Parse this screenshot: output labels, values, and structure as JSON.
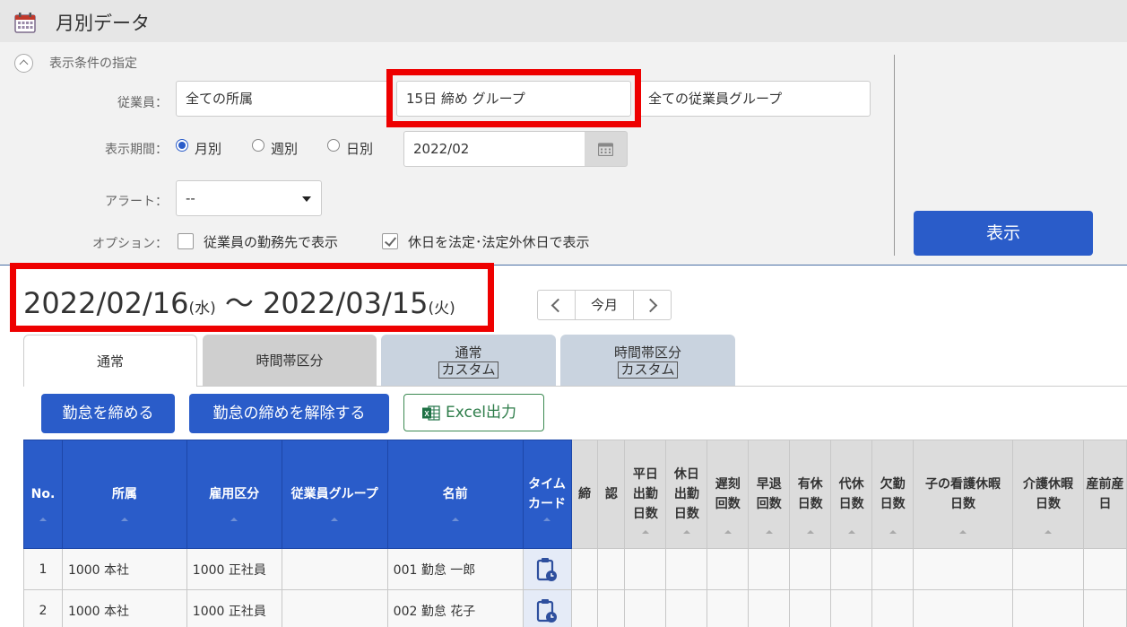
{
  "header": {
    "title": "月別データ",
    "icon": "calendar-icon"
  },
  "filter": {
    "heading": "表示条件の指定",
    "employee_label": "従業員：",
    "affiliation_value": "全ての所属",
    "closing_group_value": "15日 締め グループ",
    "employee_group_value": "全ての従業員グループ",
    "period_label": "表示期間：",
    "period_options": [
      "月別",
      "週別",
      "日別"
    ],
    "period_selected": "月別",
    "month_value": "2022/02",
    "alert_label": "アラート：",
    "alert_value": "--",
    "option_label": "オプション：",
    "option_workplace": "従業員の勤務先で表示",
    "option_workplace_checked": false,
    "option_holiday": "休日を法定･法定外休日で表示",
    "option_holiday_checked": true,
    "show_button": "表示"
  },
  "range": {
    "start": "2022/02/16",
    "start_dow": "(水)",
    "separator": "〜",
    "end": "2022/03/15",
    "end_dow": "(火)"
  },
  "nav": {
    "today": "今月"
  },
  "tabs": [
    {
      "label": "通常",
      "sub": ""
    },
    {
      "label": "時間帯区分",
      "sub": ""
    },
    {
      "label": "通常",
      "sub": "カスタム"
    },
    {
      "label": "時間帯区分",
      "sub": "カスタム"
    }
  ],
  "actions": {
    "close": "勤怠を締める",
    "unclose": "勤怠の締めを解除する",
    "excel": "Excel出力"
  },
  "table": {
    "headers": {
      "no": "No.",
      "affiliation": "所属",
      "employment": "雇用区分",
      "group": "従業員グループ",
      "name": "名前",
      "timecard_1": "タイム",
      "timecard_2": "カード",
      "close": "締",
      "approve": "認",
      "weekday_1": "平日",
      "weekday_2": "出勤",
      "weekday_3": "日数",
      "holiday_1": "休日",
      "holiday_2": "出勤",
      "holiday_3": "日数",
      "late_1": "遅刻",
      "late_2": "回数",
      "early_1": "早退",
      "early_2": "回数",
      "paid_1": "有休",
      "paid_2": "日数",
      "comp_1": "代休",
      "comp_2": "日数",
      "absent_1": "欠勤",
      "absent_2": "日数",
      "childcare_1": "子の看護休暇",
      "childcare_2": "日数",
      "nursing_1": "介護休暇",
      "nursing_2": "日数",
      "maternity_1": "産前産",
      "maternity_2": "日"
    },
    "rows": [
      {
        "no": "1",
        "affiliation": "1000 本社",
        "employment": "1000 正社員",
        "group": "",
        "name": "001 勤怠 一郎"
      },
      {
        "no": "2",
        "affiliation": "1000 本社",
        "employment": "1000 正社員",
        "group": "",
        "name": "002 勤怠 花子"
      }
    ]
  },
  "colors": {
    "primary": "#2a5cc9",
    "highlight": "#ee0000",
    "excel": "#2e7d4a"
  }
}
